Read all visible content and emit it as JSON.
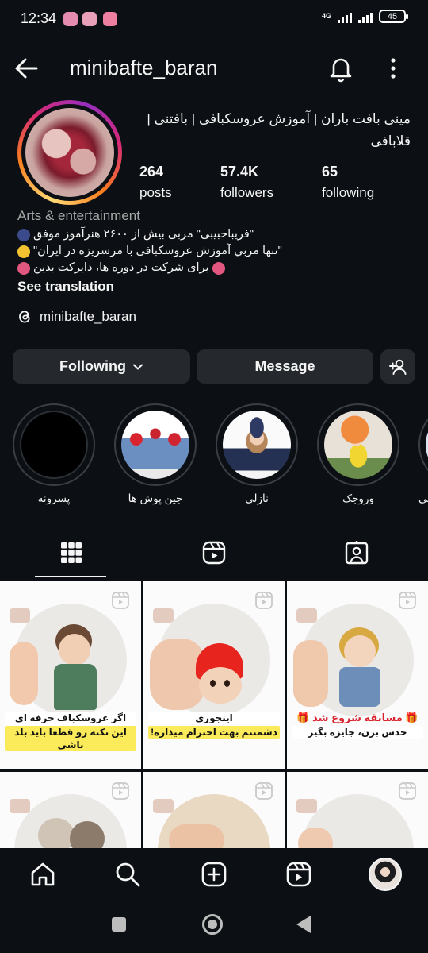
{
  "status": {
    "time": "12:34",
    "network": "4G",
    "battery": "45"
  },
  "header": {
    "username": "minibafte_baran"
  },
  "profile": {
    "full_name": "مینی بافت باران | آموزش عروسکبافی | بافتنی | قلابافی",
    "stats": [
      {
        "value": "264",
        "label": "posts"
      },
      {
        "value": "57.4K",
        "label": "followers"
      },
      {
        "value": "65",
        "label": "following"
      }
    ],
    "category": "Arts & entertainment",
    "bio": [
      "\"فریباحبیبی\" مربی بیش از ۲۶۰۰ هنرآموز موفق",
      "\"تنها مربي آموزش عروسکبافی با مرسریزه در ایران\"",
      "برای شرکت در دوره ها، دایرکت بدین"
    ],
    "see_translation": "See translation",
    "threads_handle": "minibafte_baran"
  },
  "actions": {
    "following": "Following",
    "message": "Message"
  },
  "highlights": [
    {
      "label": "پسرونه"
    },
    {
      "label": "جین پوش ها"
    },
    {
      "label": "نازلی"
    },
    {
      "label": "وروجک"
    },
    {
      "label": "نی"
    }
  ],
  "posts": [
    {
      "line1": "اگر عروسکباف حرفه ای هستی",
      "line2": "این نکته رو قطعا باید بلد باشی"
    },
    {
      "line1": "اینجوری",
      "line2": "دشمنتم بهت احترام میذاره!"
    },
    {
      "line1": "🎁 مسابقه شروع شد 🎁",
      "line2": "حدس بزن، جایزه بگیر"
    }
  ],
  "colors": {
    "background": "#0c1014",
    "button": "#25292e",
    "muted": "#a8a8a8",
    "caption_yellow": "#fbeb5a"
  }
}
